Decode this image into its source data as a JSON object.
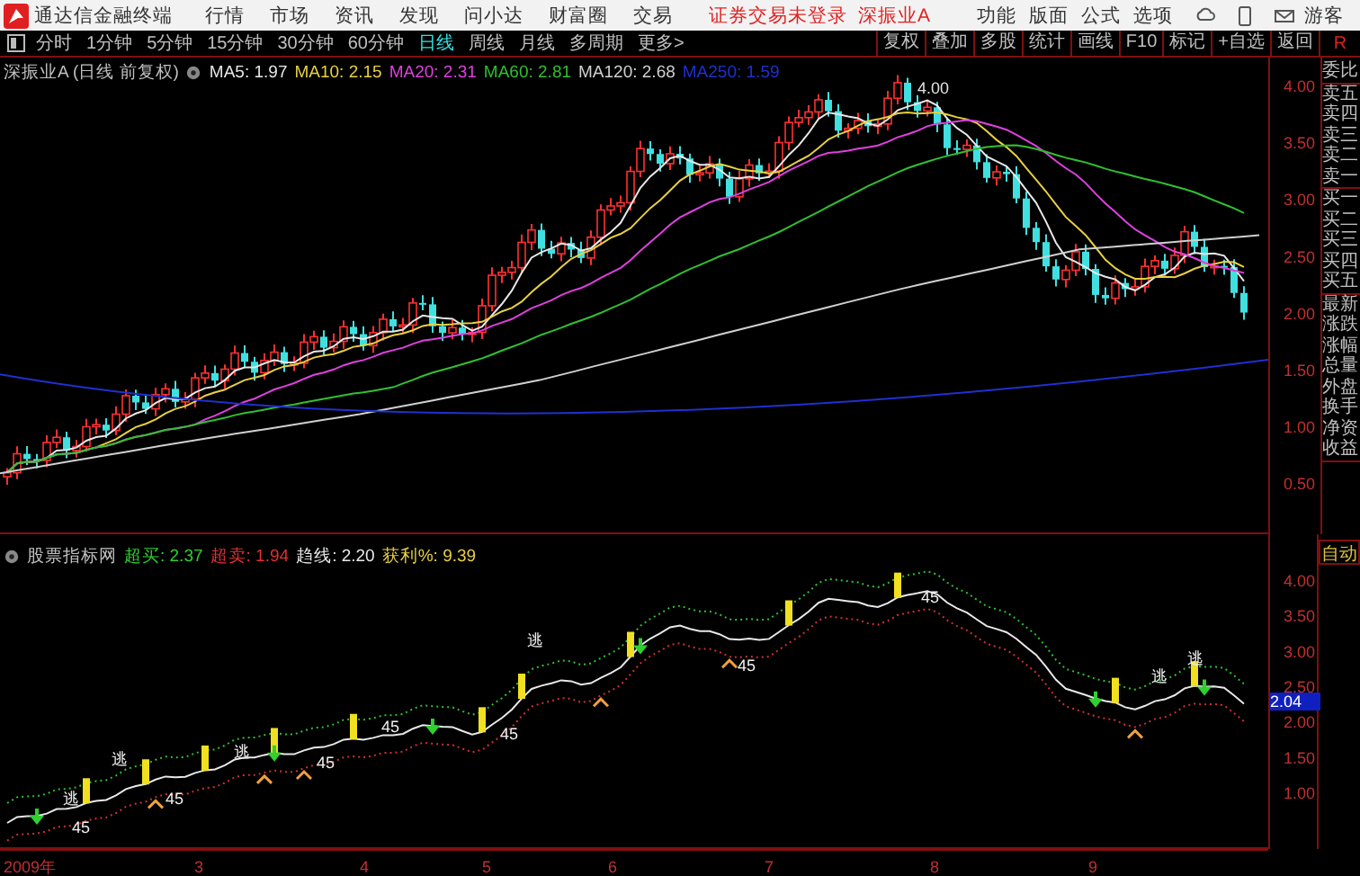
{
  "menu_bar": {
    "app_title": "通达信金融终端",
    "menus": [
      "行情",
      "市场",
      "资讯",
      "发现",
      "问小达",
      "财富圈",
      "交易"
    ],
    "notice": "证券交易未登录",
    "stock": "深振业A",
    "tools": [
      "功能",
      "版面",
      "公式",
      "选项"
    ],
    "user": "游客"
  },
  "period_tabs": [
    {
      "label": "分时",
      "selected": false
    },
    {
      "label": "1分钟",
      "selected": false
    },
    {
      "label": "5分钟",
      "selected": false
    },
    {
      "label": "15分钟",
      "selected": false
    },
    {
      "label": "30分钟",
      "selected": false
    },
    {
      "label": "60分钟",
      "selected": false
    },
    {
      "label": "日线",
      "selected": true
    },
    {
      "label": "周线",
      "selected": false
    },
    {
      "label": "月线",
      "selected": false
    },
    {
      "label": "多周期",
      "selected": false
    },
    {
      "label": "更多>",
      "selected": false
    }
  ],
  "toolbar_buttons": [
    "复权",
    "叠加",
    "多股",
    "统计",
    "画线",
    "F10",
    "标记",
    "+自选",
    "返回"
  ],
  "corner_button": "R",
  "main_chart": {
    "title": "深振业A (日线 前复权)",
    "indicators": [
      {
        "label": "MA5: 1.97",
        "color": "#e8e8e8"
      },
      {
        "label": "MA10: 2.15",
        "color": "#e8d040"
      },
      {
        "label": "MA20: 2.31",
        "color": "#e040e0"
      },
      {
        "label": "MA60: 2.81",
        "color": "#30c030"
      },
      {
        "label": "MA120: 2.68",
        "color": "#d0d0d0"
      },
      {
        "label": "MA250: 1.59",
        "color": "#2030d0"
      }
    ],
    "peak_label": "4.00",
    "axis_labels": [
      "4.00",
      "3.50",
      "3.00",
      "2.50",
      "2.00",
      "1.50",
      "1.00",
      "0.50"
    ]
  },
  "indicator_chart": {
    "title": "股票指标网",
    "values": [
      {
        "label": "超买: 2.37",
        "color": "#30d030"
      },
      {
        "label": "超卖: 1.94",
        "color": "#e03030"
      },
      {
        "label": "趋线: 2.20",
        "color": "#e8e8e8"
      },
      {
        "label": "获利%: 9.39",
        "color": "#e8d040"
      }
    ],
    "marks": [
      "逃",
      "逃",
      "逃",
      "逃",
      "逃",
      "逃",
      "45",
      "45",
      "45",
      "45",
      "45",
      "45",
      "45"
    ],
    "price_tag": "2.04",
    "axis_labels": [
      "4.00",
      "3.50",
      "3.00",
      "2.50",
      "2.00",
      "1.50",
      "1.00"
    ]
  },
  "quote_panel": {
    "groups": [
      [
        "委比"
      ],
      [
        "卖五",
        "卖四",
        "卖三",
        "卖二",
        "卖一"
      ],
      [
        "买一",
        "买二",
        "买三",
        "买四",
        "买五"
      ],
      [
        "最新",
        "涨跌",
        "涨幅",
        "总量",
        "外盘",
        "换手",
        "净资",
        "收益"
      ]
    ],
    "mode_button": "自动"
  },
  "time_axis": [
    "2009年",
    "3",
    "4",
    "5",
    "6",
    "7",
    "8",
    "9"
  ]
}
